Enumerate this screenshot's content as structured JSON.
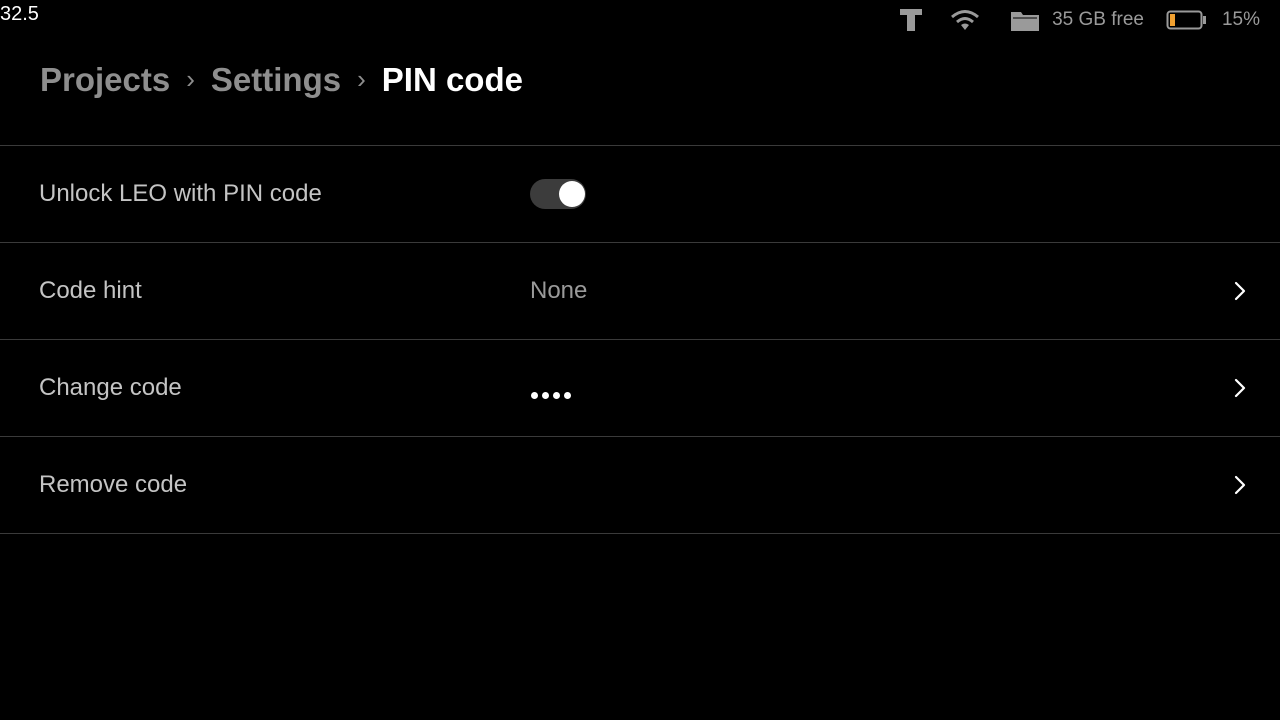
{
  "corner_readout": "32.5",
  "status_bar": {
    "storage_free": "35 GB free",
    "battery_percent_label": "15%",
    "battery_level": 0.15,
    "battery_color": "#f0a030",
    "icons": [
      "tool-icon",
      "wifi-icon",
      "folder-icon",
      "battery-icon"
    ]
  },
  "breadcrumb": {
    "items": [
      "Projects",
      "Settings",
      "PIN code"
    ],
    "separator": "›"
  },
  "settings": {
    "unlock": {
      "label": "Unlock LEO with PIN code",
      "toggle_on": true
    },
    "hint": {
      "label": "Code hint",
      "value": "None"
    },
    "change": {
      "label": "Change code",
      "masked_digits": 4
    },
    "remove": {
      "label": "Remove code"
    }
  }
}
